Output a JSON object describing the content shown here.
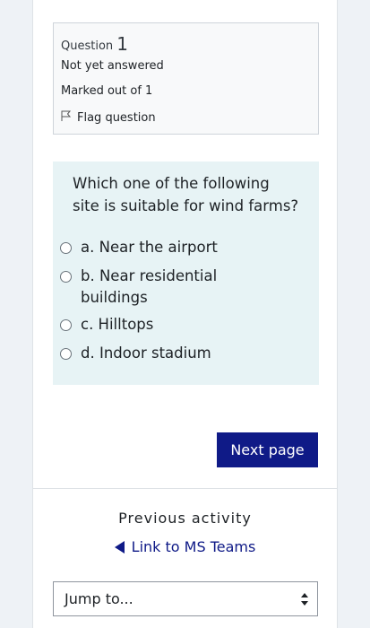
{
  "question_info": {
    "label": "Question",
    "number": "1",
    "status": "Not yet answered",
    "marks": "Marked out of 1",
    "flag_label": "Flag question"
  },
  "question": {
    "prompt": "Which one of the following site is suitable for wind farms?",
    "answers": [
      {
        "label": "a. Near the airport"
      },
      {
        "label": "b. Near residential buildings"
      },
      {
        "label": "c. Hilltops"
      },
      {
        "label": "d. Indoor stadium"
      }
    ]
  },
  "navigation": {
    "next_label": "Next page",
    "previous_heading": "Previous activity",
    "previous_link": "Link to MS Teams",
    "jump_placeholder": "Jump to..."
  },
  "colors": {
    "primary": "#0f1a87",
    "question_bg": "#e7f3f5",
    "info_bg": "#f8f9fa"
  }
}
